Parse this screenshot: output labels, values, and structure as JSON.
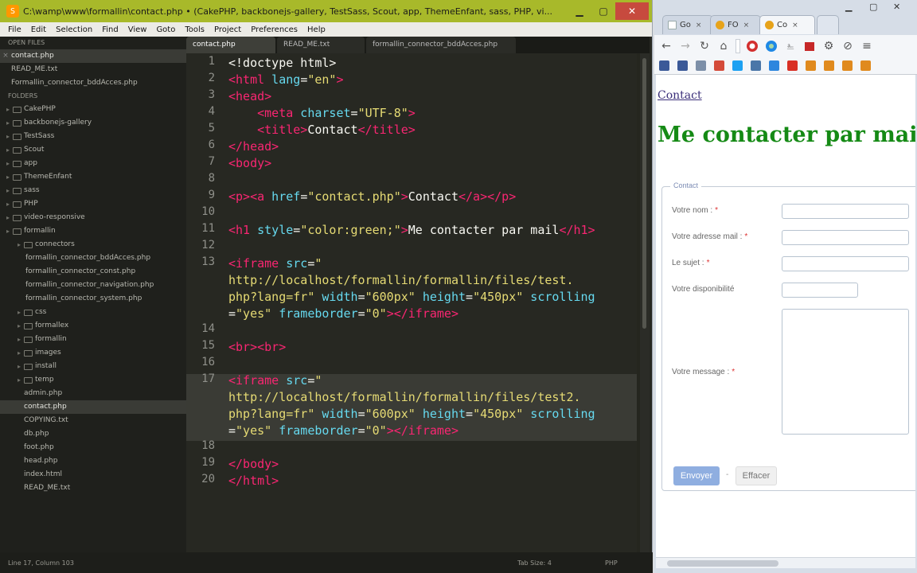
{
  "editor": {
    "title": "C:\\wamp\\www\\formallin\\contact.php • (CakePHP, backbonejs-gallery, TestSass, Scout, app, ThemeEnfant, sass, PHP, vi...",
    "menu": [
      "File",
      "Edit",
      "Selection",
      "Find",
      "View",
      "Goto",
      "Tools",
      "Project",
      "Preferences",
      "Help"
    ],
    "tabs": [
      "contact.php",
      "READ_ME.txt",
      "formallin_connector_bddAcces.php"
    ],
    "sidebar": {
      "open_files_header": "OPEN FILES",
      "open_files": [
        "contact.php",
        "READ_ME.txt",
        "Formallin_connector_bddAcces.php"
      ],
      "folders_header": "FOLDERS",
      "folders": [
        {
          "label": "CakePHP",
          "indent": 0
        },
        {
          "label": "backbonejs-gallery",
          "indent": 0
        },
        {
          "label": "TestSass",
          "indent": 0
        },
        {
          "label": "Scout",
          "indent": 0
        },
        {
          "label": "app",
          "indent": 0
        },
        {
          "label": "ThemeEnfant",
          "indent": 0
        },
        {
          "label": "sass",
          "indent": 0
        },
        {
          "label": "PHP",
          "indent": 0
        },
        {
          "label": "video-responsive",
          "indent": 0
        },
        {
          "label": "formallin",
          "indent": 0
        },
        {
          "label": "connectors",
          "indent": 1
        },
        {
          "label": "formallin_connector_bddAcces.php",
          "indent": 2
        },
        {
          "label": "formallin_connector_const.php",
          "indent": 2
        },
        {
          "label": "formallin_connector_navigation.php",
          "indent": 2
        },
        {
          "label": "formallin_connector_system.php",
          "indent": 2
        },
        {
          "label": "css",
          "indent": 1
        },
        {
          "label": "formallex",
          "indent": 1
        },
        {
          "label": "formallin",
          "indent": 1
        },
        {
          "label": "images",
          "indent": 1
        },
        {
          "label": "install",
          "indent": 1
        },
        {
          "label": "temp",
          "indent": 1
        },
        {
          "label": "admin.php",
          "indent": 1
        },
        {
          "label": "contact.php",
          "indent": 1
        },
        {
          "label": "COPYING.txt",
          "indent": 1
        },
        {
          "label": "db.php",
          "indent": 1
        },
        {
          "label": "foot.php",
          "indent": 1
        },
        {
          "label": "head.php",
          "indent": 1
        },
        {
          "label": "index.html",
          "indent": 1
        },
        {
          "label": "READ_ME.txt",
          "indent": 1
        }
      ]
    },
    "line_numbers": [
      "1",
      "2",
      "3",
      "4",
      "5",
      "6",
      "7",
      "8",
      "9",
      "10",
      "11",
      "12",
      "13",
      "14",
      "15",
      "16",
      "17",
      "18",
      "19",
      "20"
    ],
    "code": {
      "l1": "<!doctype html>",
      "l2_tag": "<html",
      "l2_attr": " lang",
      "l2_eq": "=",
      "l2_val": "\"en\"",
      "l2_end": ">",
      "l3": "<head>",
      "l4_tag": "    <meta",
      "l4_attr": " charset",
      "l4_eq": "=",
      "l4_val": "\"UTF-8\"",
      "l4_end": ">",
      "l5_open": "    <title>",
      "l5_text": "Contact",
      "l5_close": "</title>",
      "l6": "</head>",
      "l7": "<body>",
      "l9_a": "<p><a",
      "l9_attr": " href",
      "l9_eq": "=",
      "l9_val": "\"contact.php\"",
      "l9_gt": ">",
      "l9_text": "Contact",
      "l9_close": "</a></p>",
      "l11_tag": "<h1",
      "l11_attr": " style",
      "l11_eq": "=",
      "l11_val": "\"color:green;\"",
      "l11_gt": ">",
      "l11_text": "Me contacter par mail",
      "l11_close": "</h1>",
      "l13a_tag": "<iframe",
      "l13a_attr": " src",
      "l13a_eq": "=",
      "l13a_val": "\"",
      "l13b": "http://localhost/formallin/formallin/files/test.",
      "l13c_val": "php?lang=fr\"",
      "l13c_attr1": " width",
      "l13c_eq1": "=",
      "l13c_val1": "\"600px\"",
      "l13c_attr2": " height",
      "l13c_eq2": "=",
      "l13c_val2": "\"450px\"",
      "l13c_attr3": " scrolling",
      "l13d_eq": "=",
      "l13d_val": "\"yes\"",
      "l13d_attr": " frameborder",
      "l13d_eq2": "=",
      "l13d_val2": "\"0\"",
      "l13d_close": "></iframe>",
      "l15": "<br><br>",
      "l17a_tag": "<iframe",
      "l17a_attr": " src",
      "l17a_eq": "=",
      "l17a_val": "\"",
      "l17b": "http://localhost/formallin/formallin/files/test2.",
      "l17c_val": "php?lang=fr\"",
      "l17c_attr1": " width",
      "l17c_eq1": "=",
      "l17c_val1": "\"600px\"",
      "l17c_attr2": " height",
      "l17c_eq2": "=",
      "l17c_val2": "\"450px\"",
      "l17c_attr3": " scrolling",
      "l17d_eq": "=",
      "l17d_val": "\"yes\"",
      "l17d_attr": " frameborder",
      "l17d_eq2": "=",
      "l17d_val2": "\"0\"",
      "l17d_close": "></iframe>",
      "l19": "</body>",
      "l20": "</html>"
    },
    "status": {
      "position": "Line 17, Column 103",
      "tab_size": "Tab Size: 4",
      "syntax": "PHP"
    }
  },
  "browser": {
    "tabs": [
      {
        "label": "Go"
      },
      {
        "label": "FO"
      },
      {
        "label": "Co"
      }
    ],
    "page": {
      "link": "Contact",
      "heading": "Me contacter par mail",
      "legend": "Contact",
      "fields": {
        "name_label": "Votre nom :",
        "email_label": "Votre adresse mail :",
        "subject_label": "Le sujet :",
        "availability_label": "Votre disponibilité",
        "message_label": "Votre message :",
        "required_mark": "*"
      },
      "send_button": "Envoyer",
      "separator": "-",
      "clear_button": "Effacer"
    }
  }
}
